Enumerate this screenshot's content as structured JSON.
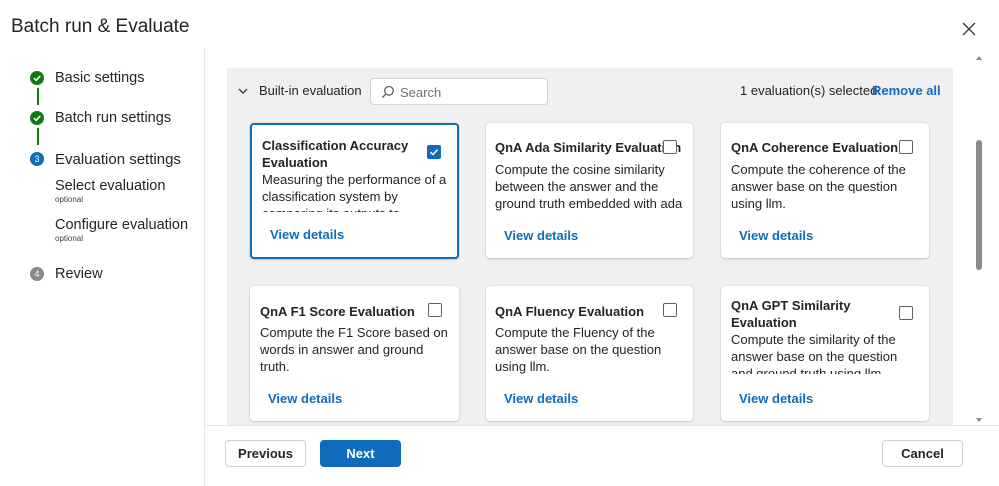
{
  "dialog": {
    "title": "Batch run & Evaluate",
    "close_icon": "close-icon"
  },
  "stepper": {
    "steps": [
      {
        "label": "Basic settings",
        "status": "done"
      },
      {
        "label": "Batch run settings",
        "status": "done"
      },
      {
        "label": "Evaluation settings",
        "status": "current",
        "number": "3"
      },
      {
        "label": "Review",
        "status": "pending",
        "number": "4"
      }
    ],
    "substeps": [
      {
        "label": "Select evaluation",
        "note": "optional",
        "active": true
      },
      {
        "label": "Configure evaluation",
        "note": "optional",
        "active": false
      }
    ]
  },
  "evaluation": {
    "section_label": "Built-in evaluation",
    "search_placeholder": "Search",
    "search_value": "",
    "selected_count": "1 evaluation(s) selected",
    "remove_all": "Remove all",
    "view_details": "View details",
    "cards": [
      {
        "title": "Classification Accuracy Evaluation",
        "description": "Measuring the performance of a classification system by comparing its outputs to groundtruth.",
        "checked": true
      },
      {
        "title": "QnA Ada Similarity Evaluation",
        "description": "Compute the cosine similarity between the answer and the ground truth embedded with ada",
        "checked": false
      },
      {
        "title": "QnA Coherence Evaluation",
        "description": "Compute the coherence of the answer base on the question using llm.",
        "checked": false
      },
      {
        "title": "QnA F1 Score Evaluation",
        "description": "Compute the F1 Score based on words in answer and ground truth.",
        "checked": false
      },
      {
        "title": "QnA Fluency Evaluation",
        "description": "Compute the Fluency of the answer base on the question using llm.",
        "checked": false
      },
      {
        "title": "QnA GPT Similarity Evaluation",
        "description": "Compute the similarity of the answer base on the question and ground truth using llm.",
        "checked": false
      }
    ]
  },
  "footer": {
    "previous": "Previous",
    "next": "Next",
    "cancel": "Cancel"
  },
  "colors": {
    "accent": "#0f6cbd",
    "success": "#107c10",
    "panel_bg": "#f0f0f0"
  }
}
